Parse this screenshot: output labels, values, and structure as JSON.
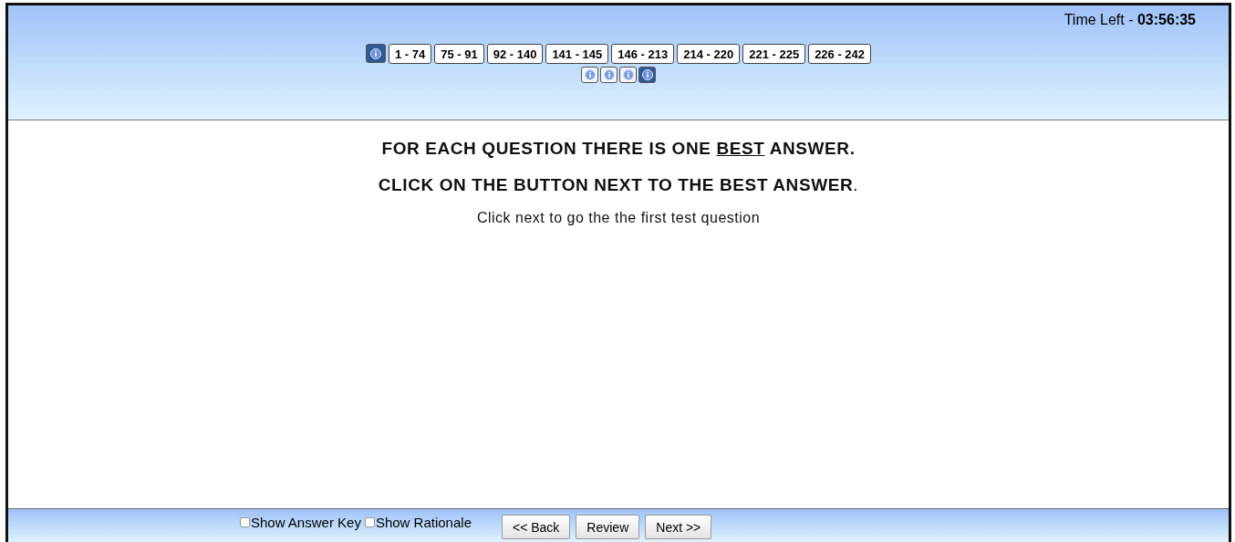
{
  "timer": "Time Left - **03:56:35**",
  "section_nav": {
    "info_buttons": [
      {
        "selected": true
      }
    ],
    "ranges": [
      {
        "label": "1 - 74",
        "selected": false
      },
      {
        "label": "75 - 91",
        "selected": false
      },
      {
        "label": "92 - 140",
        "selected": false
      },
      {
        "label": "141 - 145",
        "selected": false
      },
      {
        "label": "146 - 213",
        "selected": false
      },
      {
        "label": "214 - 220",
        "selected": false
      },
      {
        "label": "221 - 225",
        "selected": false
      },
      {
        "label": "226 - 242",
        "selected": false
      }
    ]
  },
  "sub_info_buttons": [
    {
      "selected": false
    },
    {
      "selected": false
    },
    {
      "selected": false
    },
    {
      "selected": true
    }
  ],
  "instructions": [
    [
      {
        "text": "FOR EACH QUESTION THERE IS ONE ",
        "underlined": false
      },
      {
        "text": "BEST",
        "underlined": true
      },
      {
        "text": " ANSWER.",
        "underlined": false
      }
    ],
    "**CLICK ON THE BUTTON NEXT TO THE BEST ANSWER**."
  ],
  "hint": "Click next to go the the first test question",
  "options": [
    {
      "label": "Show Answer Key",
      "checked": false
    },
    {
      "label": "Show Rationale",
      "checked": false
    }
  ],
  "buttons": [
    "<< Back",
    "Review",
    "Next >>"
  ]
}
